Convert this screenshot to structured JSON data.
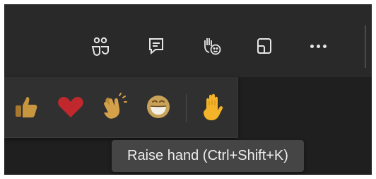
{
  "toolbar": {
    "icons": [
      "people-icon",
      "chat-icon",
      "raise-hand-react-icon",
      "rooms-icon",
      "more-options-icon"
    ],
    "icon_color": "#e6e6e6",
    "background": "#292929"
  },
  "reactions": {
    "items": [
      {
        "name": "like",
        "icon": "thumbs-up-icon",
        "color": "#c8963e"
      },
      {
        "name": "heart",
        "icon": "heart-icon",
        "color": "#c0282e"
      },
      {
        "name": "applause",
        "icon": "clapping-hands-icon",
        "color": "#d4a14a"
      },
      {
        "name": "laugh",
        "icon": "laughing-face-icon",
        "color": "#c9a259"
      },
      {
        "name": "raise-hand",
        "icon": "raised-hand-icon",
        "color": "#f4b329"
      }
    ]
  },
  "tooltip": {
    "text": "Raise hand (Ctrl+Shift+K)"
  }
}
